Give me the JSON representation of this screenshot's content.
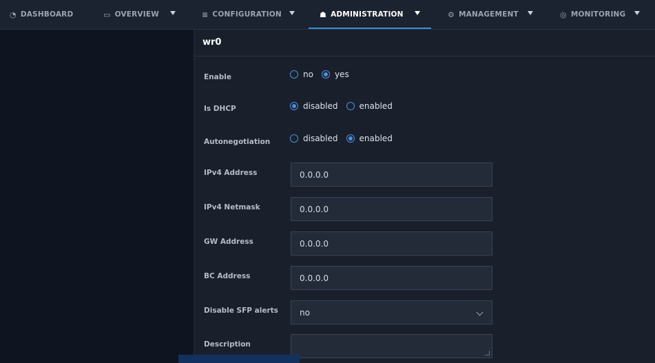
{
  "nav": {
    "items": [
      {
        "label": "DASHBOARD",
        "icon": "dashboard-icon"
      },
      {
        "label": "OVERVIEW",
        "icon": "monitor-icon"
      },
      {
        "label": "CONFIGURATION",
        "icon": "sliders-icon"
      },
      {
        "label": "ADMINISTRATION",
        "icon": "users-icon",
        "active": true
      },
      {
        "label": "MANAGEMENT",
        "icon": "gear-icon"
      },
      {
        "label": "MONITORING",
        "icon": "eye-icon"
      }
    ]
  },
  "form": {
    "title": "wr0",
    "enable": {
      "label": "Enable",
      "options": [
        "no",
        "yes"
      ],
      "selected": "yes"
    },
    "is_dhcp": {
      "label": "Is DHCP",
      "options": [
        "disabled",
        "enabled"
      ],
      "selected": "disabled"
    },
    "autoneg": {
      "label": "Autonegotiation",
      "options": [
        "disabled",
        "enabled"
      ],
      "selected": "enabled"
    },
    "ipv4_address": {
      "label": "IPv4 Address",
      "value": "0.0.0.0"
    },
    "ipv4_netmask": {
      "label": "IPv4 Netmask",
      "value": "0.0.0.0"
    },
    "gw_address": {
      "label": "GW Address",
      "value": "0.0.0.0"
    },
    "bc_address": {
      "label": "BC Address",
      "value": "0.0.0.0"
    },
    "sfp_alerts": {
      "label": "Disable SFP alerts",
      "value": "no"
    },
    "description": {
      "label": "Description",
      "value": ""
    }
  },
  "colors": {
    "accent": "#4a8fe0",
    "nav_active_underline": "#3a8fd9",
    "panel_bg": "#1a202b",
    "sidebar_bg": "#0e1420"
  }
}
